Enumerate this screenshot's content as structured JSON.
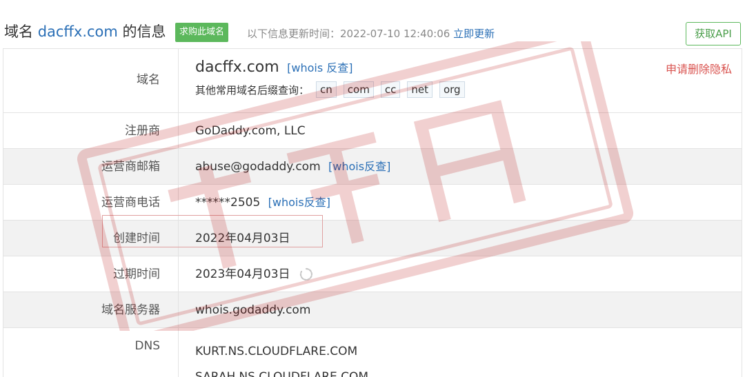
{
  "header": {
    "title_prefix": "域名 ",
    "title_domain": "dacffx.com",
    "title_suffix": " 的信息",
    "buy_badge": "求购此域名",
    "update_text": "以下信息更新时间：2022-07-10 12:40:06",
    "update_link": "立即更新",
    "api_button": "获取API"
  },
  "rows": {
    "domain": {
      "label": "域名",
      "value": "dacffx.com",
      "whois_link": "[whois 反查]",
      "suffix_label": "其他常用域名后缀查询：",
      "suffixes": [
        "cn",
        "com",
        "cc",
        "net",
        "org"
      ],
      "privacy_link": "申请删除隐私"
    },
    "registrar": {
      "label": "注册商",
      "value": "GoDaddy.com, LLC"
    },
    "email": {
      "label": "运营商邮箱",
      "value": "abuse@godaddy.com",
      "whois_link": "[whois反查]"
    },
    "phone": {
      "label": "运营商电话",
      "value": "******2505",
      "whois_link": "[whois反查]"
    },
    "created": {
      "label": "创建时间",
      "value": "2022年04月03日"
    },
    "expires": {
      "label": "过期时间",
      "value": "2023年04月03日"
    },
    "whois_server": {
      "label": "域名服务器",
      "value": "whois.godaddy.com"
    },
    "dns": {
      "label": "DNS",
      "values": [
        "KURT.NS.CLOUDFLARE.COM",
        "SARAH.NS.CLOUDFLARE.COM"
      ]
    }
  },
  "icons": {
    "refresh": "refresh-spinner-icon",
    "stamp": "watermark-stamp"
  },
  "colors": {
    "link": "#2a6fb6",
    "badge": "#5cb85c",
    "privacy": "#d9534f",
    "alt_row": "#f2f2f2"
  }
}
